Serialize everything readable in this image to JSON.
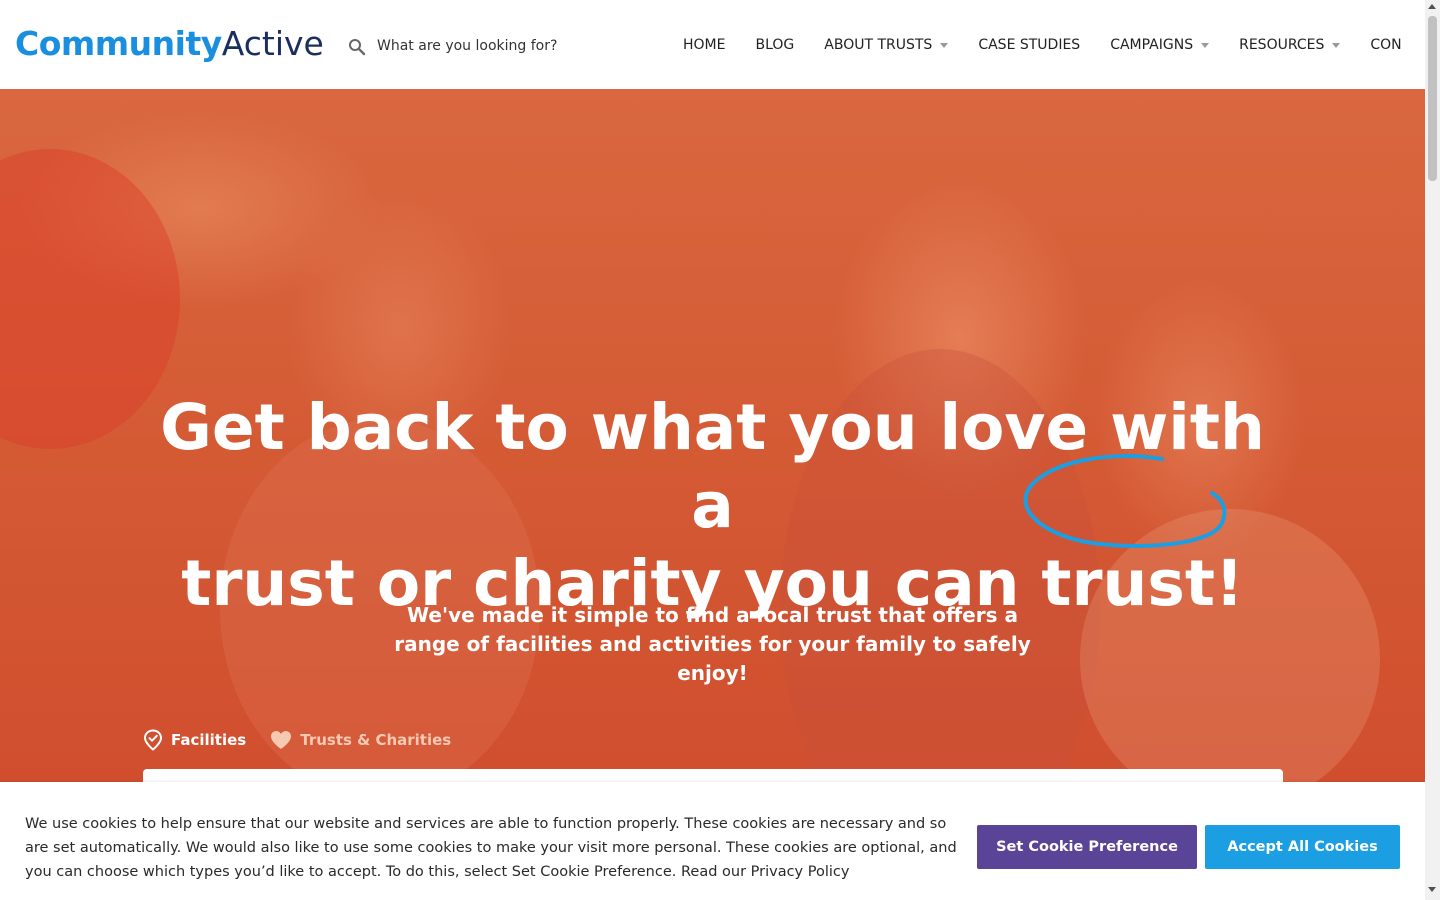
{
  "header": {
    "logo": {
      "part1": "Community",
      "part2": "Active"
    },
    "search": {
      "placeholder": "What are you looking for?",
      "icon": "search-icon"
    },
    "nav": [
      {
        "label": "HOME",
        "dropdown": false
      },
      {
        "label": "BLOG",
        "dropdown": false
      },
      {
        "label": "ABOUT TRUSTS",
        "dropdown": true
      },
      {
        "label": "CASE STUDIES",
        "dropdown": false
      },
      {
        "label": "CAMPAIGNS",
        "dropdown": true
      },
      {
        "label": "RESOURCES",
        "dropdown": true
      },
      {
        "label": "CON",
        "dropdown": false
      }
    ]
  },
  "hero": {
    "title_line1": "Get back to what you love with a",
    "title_line2_prefix": "trust or charity you can ",
    "title_highlight": "trust!",
    "subtitle": "We've made it simple to find a local trust that offers a range of facilities and activities for your family to safely enjoy!",
    "tabs": [
      {
        "label": "Facilities",
        "icon": "location-check-icon",
        "active": true
      },
      {
        "label": "Trusts & Charities",
        "icon": "heart-icon",
        "active": false
      }
    ]
  },
  "cookie_banner": {
    "text": "We use cookies to help ensure that our website and services are able to function properly. These cookies are necessary and so are set automatically. We would also like to use some cookies to make your visit more personal. These cookies are optional, and you can choose which types you’d like to accept. To do this, select Set Cookie Preference. Read our Privacy Policy",
    "preference_button": "Set Cookie Preference",
    "accept_button": "Accept All Cookies"
  },
  "colors": {
    "brand_blue": "#1a8fe0",
    "brand_navy": "#1a2f5e",
    "hero_orange": "#d45a34",
    "preference_purple": "#5a4497",
    "accept_blue": "#1b9fe2"
  }
}
